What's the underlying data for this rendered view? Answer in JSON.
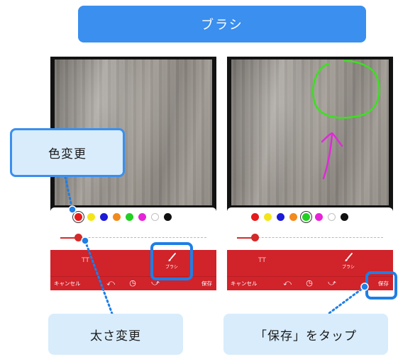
{
  "title": "ブラシ",
  "colors": {
    "banner": "#3a8fef",
    "toolbar": "#d0232a",
    "callout_bg": "#d8ecfb",
    "highlight": "#1e7fe6",
    "stroke_green": "#39e21d",
    "stroke_magenta": "#e02ad8"
  },
  "palette": [
    {
      "name": "red",
      "color": "#e61b1b"
    },
    {
      "name": "yellow",
      "color": "#f4e51a"
    },
    {
      "name": "blue",
      "color": "#1c1bd8"
    },
    {
      "name": "orange",
      "color": "#f28a1d"
    },
    {
      "name": "green",
      "color": "#22d022"
    },
    {
      "name": "magenta",
      "color": "#e623d8"
    },
    {
      "name": "white",
      "color": "#ffffff"
    },
    {
      "name": "black",
      "color": "#111111"
    }
  ],
  "left_screen": {
    "selected_color": "red",
    "brush_size": 0.12,
    "text_tool_label": "TT",
    "brush_label": "ブラシ",
    "cancel_label": "キャンセル",
    "save_label": "保存"
  },
  "right_screen": {
    "selected_color": "green",
    "brush_size": 0.12,
    "text_tool_label": "TT",
    "brush_label": "ブラシ",
    "cancel_label": "キャンセル",
    "save_label": "保存"
  },
  "callouts": {
    "color_change": "色変更",
    "size_change": "太さ変更",
    "tap_save": "「保存」をタップ"
  },
  "icons": {
    "undo": "undo-icon",
    "history": "history-icon",
    "redo": "redo-icon",
    "brush": "brush-icon"
  }
}
